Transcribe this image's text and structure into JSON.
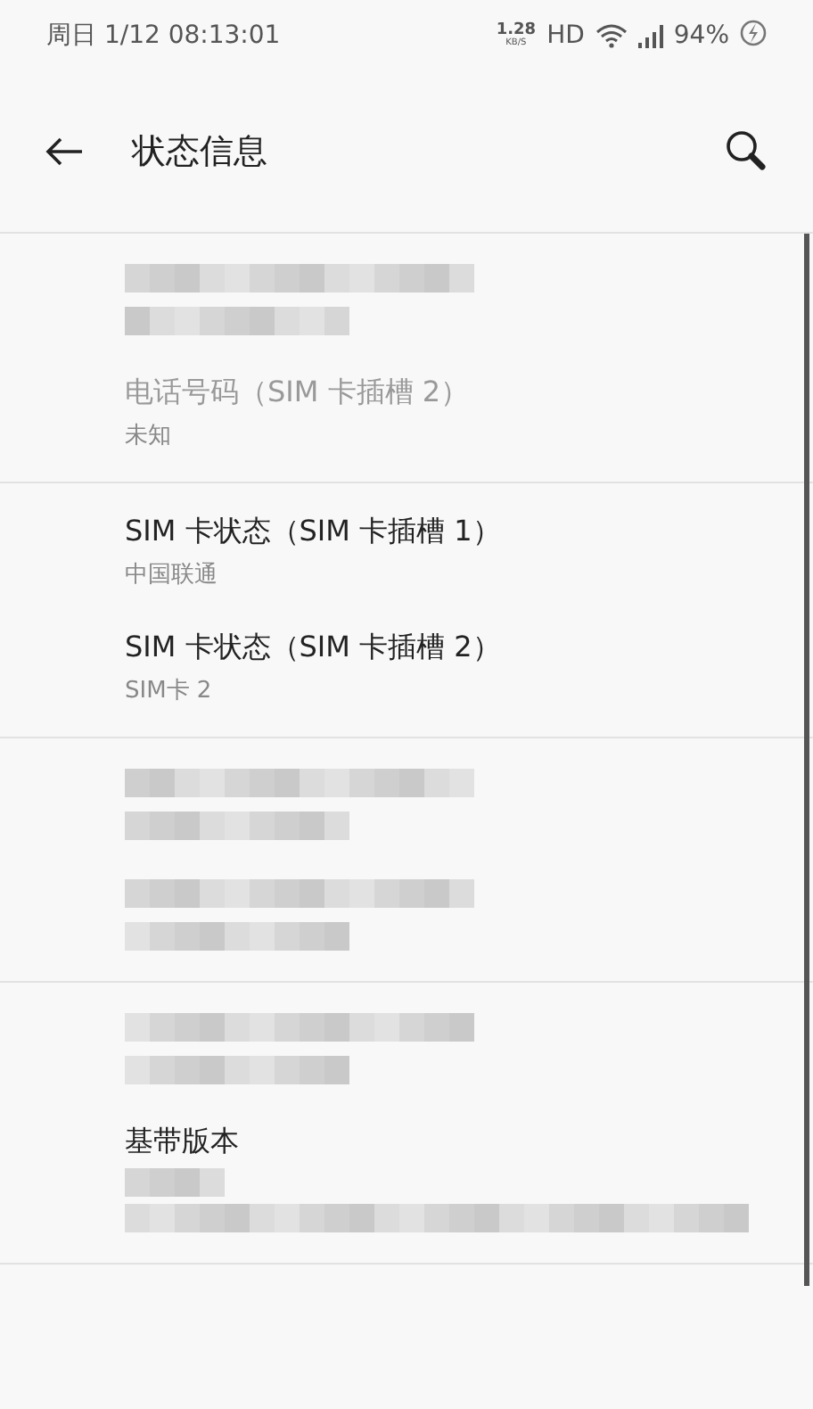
{
  "status_bar": {
    "datetime": "周日 1/12 08:13:01",
    "speed_value": "1.28",
    "speed_unit": "KB/S",
    "network_type": "HD",
    "battery": "94%",
    "charging": true
  },
  "toolbar": {
    "title": "状态信息"
  },
  "groups": [
    {
      "items": [
        {
          "kind": "masked",
          "disabled": false
        },
        {
          "kind": "text",
          "title": "电话号码（SIM 卡插槽 2）",
          "value": "未知",
          "disabled": true
        }
      ]
    },
    {
      "items": [
        {
          "kind": "text",
          "title": "SIM 卡状态（SIM 卡插槽 1）",
          "value": "中国联通",
          "disabled": false
        },
        {
          "kind": "text",
          "title": "SIM 卡状态（SIM 卡插槽 2）",
          "value": "SIM卡  2",
          "disabled": false
        }
      ]
    },
    {
      "items": [
        {
          "kind": "masked",
          "disabled": false
        },
        {
          "kind": "masked",
          "disabled": false
        }
      ]
    },
    {
      "items": [
        {
          "kind": "masked",
          "disabled": false
        },
        {
          "kind": "masked-value",
          "title": "基带版本",
          "disabled": false
        }
      ]
    }
  ]
}
